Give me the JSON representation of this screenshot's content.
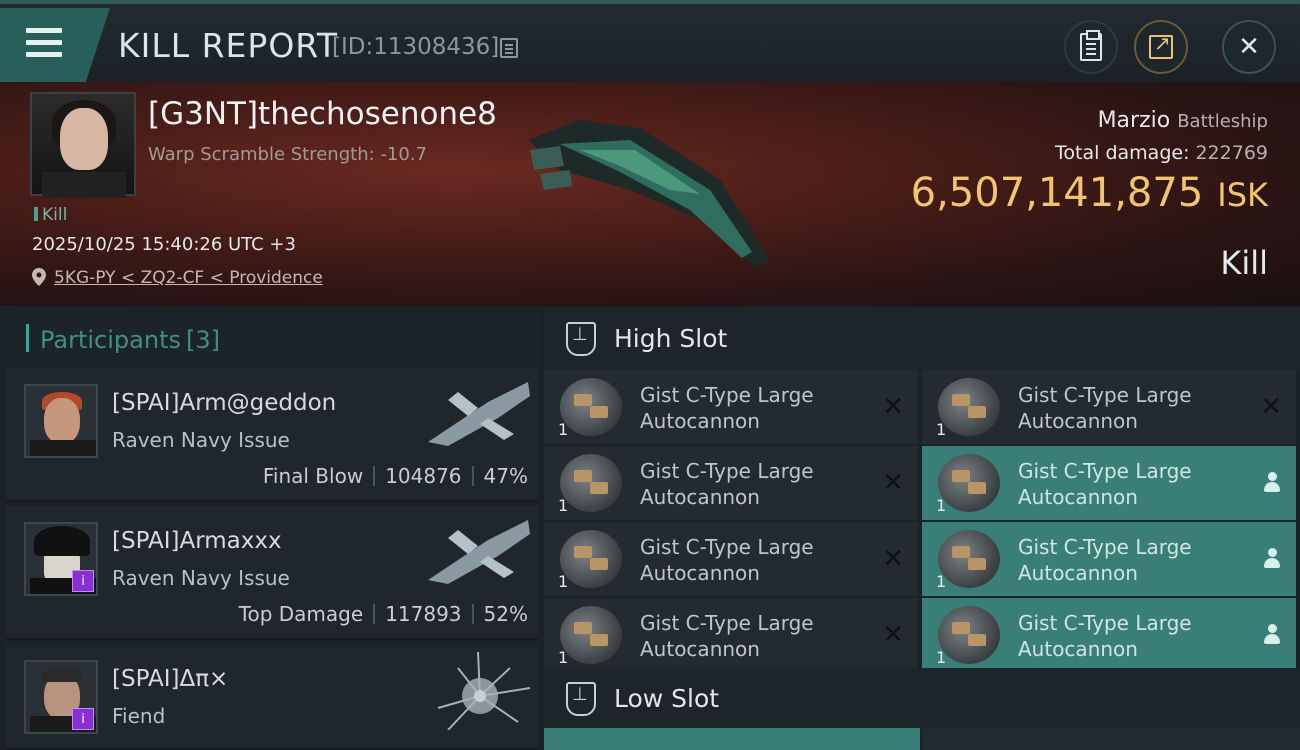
{
  "header": {
    "title": "KILL REPORT",
    "report_id": "[ID:11308436]"
  },
  "victim": {
    "name": "[G3NT]thechosenone8",
    "scramble": "Warp Scramble Strength: -10.7",
    "result_tag": "Kill",
    "timestamp": "2025/10/25 15:40:26 UTC +3",
    "location": "5KG-PY < ZQ2-CF < Providence",
    "ship_name": "Marzio",
    "ship_class": "Battleship",
    "total_damage_label": "Total damage:",
    "total_damage": "222769",
    "isk_value": "6,507,141,875",
    "isk_unit": "ISK",
    "result_big": "Kill"
  },
  "participants": {
    "title": "Participants",
    "count": "[3]",
    "list": [
      {
        "name": "[SPAI]Arm@geddon",
        "ship": "Raven Navy Issue",
        "role": "Final Blow",
        "damage": "104876",
        "percent": "47%"
      },
      {
        "name": "[SPAI]Armaxxx",
        "ship": "Raven Navy Issue",
        "role": "Top Damage",
        "damage": "117893",
        "percent": "52%"
      },
      {
        "name": "[SPAI]Δπ×",
        "ship": "Fiend",
        "role": "",
        "damage": "",
        "percent": ""
      }
    ]
  },
  "slots": {
    "high_title": "High Slot",
    "low_title": "Low Slot",
    "modules": [
      {
        "qty": "1",
        "name": "Gist C-Type Large Autocannon",
        "state": "destroyed"
      },
      {
        "qty": "1",
        "name": "Gist C-Type Large Autocannon",
        "state": "destroyed"
      },
      {
        "qty": "1",
        "name": "Gist C-Type Large Autocannon",
        "state": "destroyed"
      },
      {
        "qty": "1",
        "name": "Gist C-Type Large Autocannon",
        "state": "dropped"
      },
      {
        "qty": "1",
        "name": "Gist C-Type Large Autocannon",
        "state": "destroyed"
      },
      {
        "qty": "1",
        "name": "Gist C-Type Large Autocannon",
        "state": "dropped"
      },
      {
        "qty": "1",
        "name": "Gist C-Type Large Autocannon",
        "state": "destroyed"
      },
      {
        "qty": "1",
        "name": "Gist C-Type Large Autocannon",
        "state": "dropped"
      }
    ]
  },
  "colors": {
    "accent": "#3a7f77",
    "isk": "#f1c46e",
    "banner": "#4a1d18"
  },
  "icons": {
    "menu": "hamburger-icon",
    "copy": "copy-icon",
    "clipboard": "clipboard-icon",
    "share": "share-icon",
    "close": "close-icon",
    "location": "location-pin-icon",
    "slot": "slot-icon",
    "destroyed": "x-icon",
    "dropped": "person-icon"
  }
}
